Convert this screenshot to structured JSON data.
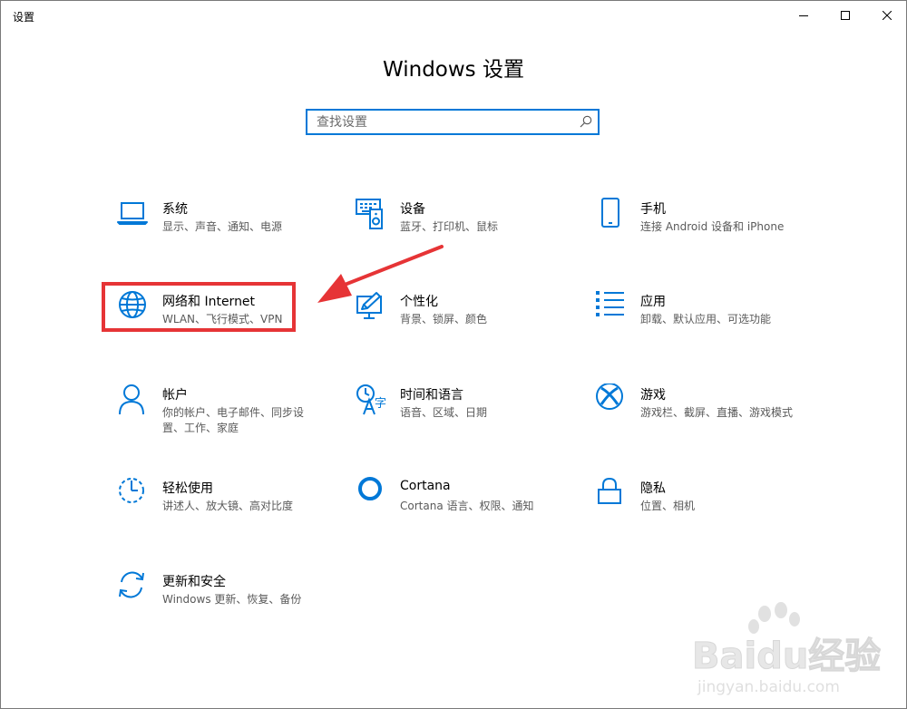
{
  "window": {
    "title": "设置",
    "controls": [
      "minimize",
      "maximize",
      "close"
    ]
  },
  "header": {
    "title": "Windows 设置"
  },
  "search": {
    "placeholder": "查找设置",
    "value": ""
  },
  "categories": [
    {
      "name": "系统",
      "desc": "显示、声音、通知、电源",
      "icon": "laptop-icon"
    },
    {
      "name": "设备",
      "desc": "蓝牙、打印机、鼠标",
      "icon": "devices-icon"
    },
    {
      "name": "手机",
      "desc": "连接 Android 设备和 iPhone",
      "icon": "phone-icon"
    },
    {
      "name": "网络和 Internet",
      "desc": "WLAN、飞行模式、VPN",
      "icon": "globe-icon"
    },
    {
      "name": "个性化",
      "desc": "背景、锁屏、颜色",
      "icon": "personalization-icon"
    },
    {
      "name": "应用",
      "desc": "卸载、默认应用、可选功能",
      "icon": "apps-list-icon"
    },
    {
      "name": "帐户",
      "desc": "你的帐户、电子邮件、同步设置、工作、家庭",
      "icon": "person-icon"
    },
    {
      "name": "时间和语言",
      "desc": "语音、区域、日期",
      "icon": "time-language-icon"
    },
    {
      "name": "游戏",
      "desc": "游戏栏、截屏、直播、游戏模式",
      "icon": "xbox-icon"
    },
    {
      "name": "轻松使用",
      "desc": "讲述人、放大镜、高对比度",
      "icon": "ease-of-access-icon"
    },
    {
      "name": "Cortana",
      "desc": "Cortana 语言、权限、通知",
      "icon": "cortana-icon"
    },
    {
      "name": "隐私",
      "desc": "位置、相机",
      "icon": "lock-icon"
    },
    {
      "name": "更新和安全",
      "desc": "Windows 更新、恢复、备份",
      "icon": "sync-icon"
    }
  ],
  "annotation": {
    "highlighted": "网络和 Internet",
    "color": "#e63436"
  },
  "watermark": {
    "brand": "Baidu经验",
    "url": "jingyan.baidu.com"
  },
  "colors": {
    "accent": "#0078d7",
    "highlight": "#e63436"
  }
}
